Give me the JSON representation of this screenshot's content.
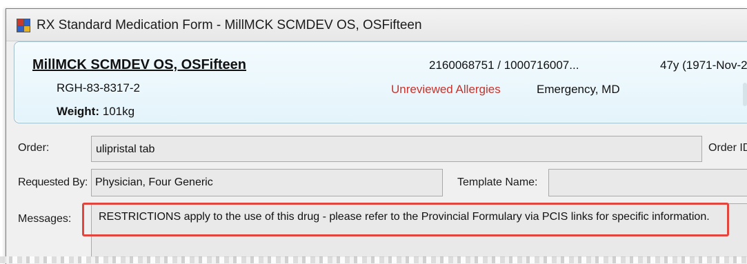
{
  "window": {
    "title": "RX Standard Medication Form - MillMCK SCMDEV OS, OSFifteen",
    "icon": "app-icon"
  },
  "patient": {
    "name": "MillMCK SCMDEV OS, OSFifteen",
    "mrn": "RGH-83-8317-2",
    "weight_label": "Weight:",
    "weight_value": "101kg",
    "ids": "2160068751 / 1000716007...",
    "age": "47y (1971-Nov-2",
    "allergy_status": "Unreviewed Allergies",
    "physician": "Emergency, MD"
  },
  "form": {
    "order_label": "Order:",
    "order_value": "ulipristal  tab",
    "order_id_label": "Order ID",
    "requested_by_label": "Requested By:",
    "requested_by_value": "Physician, Four Generic",
    "template_name_label": "Template Name:",
    "template_name_value": "",
    "messages_label": "Messages:",
    "messages_value": "RESTRICTIONS apply to the use of this drug - please refer to the Provincial Formulary via PCIS links for specific information."
  },
  "colors": {
    "allergy": "#c8322a",
    "highlight_border": "#e2443e",
    "banner_bg": "#e9f6fc"
  }
}
